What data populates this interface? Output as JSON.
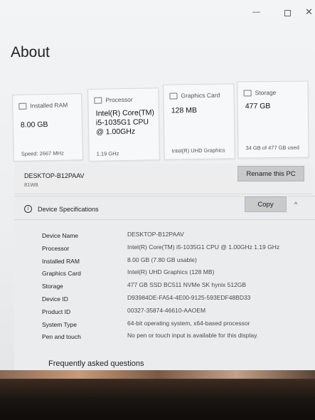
{
  "window": {
    "minimize_glyph": "—",
    "close_glyph": "✕"
  },
  "page": {
    "title": "About"
  },
  "cards": [
    {
      "title": "Installed RAM",
      "value": "8.00 GB",
      "sub": "Speed: 2667 MHz",
      "icon": "ram-icon"
    },
    {
      "title": "Processor",
      "value": "Intel(R) Core(TM) i5-1035G1 CPU @ 1.00GHz",
      "sub": "1.19 GHz",
      "icon": "processor-icon"
    },
    {
      "title": "Graphics Card",
      "value": "128 MB",
      "sub": "Intel(R) UHD Graphics",
      "icon": "graphics-card-icon"
    },
    {
      "title": "Storage",
      "value": "477 GB",
      "sub": "34 GB of 477 GB used",
      "icon": "storage-icon"
    }
  ],
  "device": {
    "name": "DESKTOP-B12PAAV",
    "model": "81W8",
    "rename_label": "Rename this PC"
  },
  "specs": {
    "header": "Device Specifications",
    "copy_label": "Copy",
    "info_glyph": "i",
    "collapse_glyph": "^",
    "rows": [
      {
        "label": "Device Name",
        "value": "DESKTOP-B12PAAV"
      },
      {
        "label": "Processor",
        "value": "Intel(R) Core(TM) i5-1035G1 CPU @ 1.00GHz   1.19 GHz"
      },
      {
        "label": "Installed RAM",
        "value": "8.00 GB (7.80 GB usable)"
      },
      {
        "label": "Graphics Card",
        "value": "Intel(R) UHD Graphics (128 MB)"
      },
      {
        "label": "Storage",
        "value": "477 GB SSD BC511 NVMe SK hynix 512GB"
      },
      {
        "label": "Device ID",
        "value": "D93984DE-FA54-4E00-9125-593EDF48BD33"
      },
      {
        "label": "Product ID",
        "value": "00327-35874-46610-AAOEM"
      },
      {
        "label": "System Type",
        "value": "64-bit operating system, x64-based processor"
      },
      {
        "label": "Pen and touch",
        "value": "No pen or touch input is available for this display."
      }
    ]
  },
  "faq": {
    "title": "Frequently asked questions"
  }
}
